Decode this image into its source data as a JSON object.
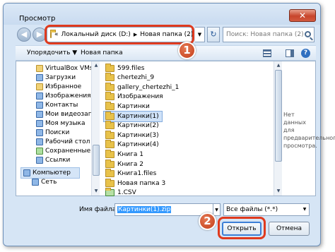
{
  "window": {
    "title": "Просмотр",
    "close_label": "✕"
  },
  "address": {
    "back_label": "◀",
    "forward_label": "▶",
    "prefix": "«",
    "crumbs": [
      "Локальный диск (D:)",
      "Новая папка (2)"
    ],
    "separator": "▶",
    "dropdown_label": "▼",
    "refresh_label": "↻"
  },
  "search": {
    "placeholder": "Поиск: Новая папка (2)"
  },
  "toolbar": {
    "organize_label": "Упорядочить ▼",
    "new_folder_label": "Новая папка",
    "help_label": "?"
  },
  "nav_pane": {
    "items": [
      {
        "label": "VirtualBox VMs",
        "icon": "folder-icon",
        "color": "yellow"
      },
      {
        "label": "Загрузки",
        "icon": "downloads-icon",
        "color": "blue"
      },
      {
        "label": "Избранное",
        "icon": "favorites-icon",
        "color": "yellow"
      },
      {
        "label": "Изображения",
        "icon": "pictures-icon",
        "color": "blue"
      },
      {
        "label": "Контакты",
        "icon": "contacts-icon",
        "color": "blue"
      },
      {
        "label": "Мои видеозапис",
        "icon": "videos-icon",
        "color": "blue"
      },
      {
        "label": "Моя музыка",
        "icon": "music-icon",
        "color": "blue"
      },
      {
        "label": "Поиски",
        "icon": "search-icon",
        "color": "blue"
      },
      {
        "label": "Рабочий стол",
        "icon": "desktop-icon",
        "color": "blue"
      },
      {
        "label": "Сохраненные иг",
        "icon": "games-icon",
        "color": "green"
      },
      {
        "label": "Ссылки",
        "icon": "links-icon",
        "color": "blue"
      },
      {
        "label": "Компьютер",
        "icon": "computer-icon",
        "color": "blue"
      },
      {
        "label": "Сеть",
        "icon": "network-icon",
        "color": "blue"
      }
    ],
    "selected_index": 11
  },
  "file_list": {
    "items": [
      {
        "label": "599.files",
        "icon": "folder-icon"
      },
      {
        "label": "chertezhi_9",
        "icon": "folder-icon"
      },
      {
        "label": "gallery_chertezhi_1",
        "icon": "folder-icon"
      },
      {
        "label": "Изображения",
        "icon": "folder-icon"
      },
      {
        "label": "Картинки",
        "icon": "folder-icon"
      },
      {
        "label": "Картинки(1)",
        "icon": "folder-icon"
      },
      {
        "label": "Картинки(2)",
        "icon": "folder-icon"
      },
      {
        "label": "Картинки(3)",
        "icon": "folder-icon"
      },
      {
        "label": "Картинки(4)",
        "icon": "folder-icon"
      },
      {
        "label": "Книга 1",
        "icon": "folder-icon"
      },
      {
        "label": "Книга 2",
        "icon": "folder-icon"
      },
      {
        "label": "Книга1.files",
        "icon": "folder-icon"
      },
      {
        "label": "Новая папка 3",
        "icon": "folder-icon"
      },
      {
        "label": "1.CSV",
        "icon": "csv-file-icon"
      }
    ],
    "selected_index": 5
  },
  "preview_text": "Нет данных для предварительного просмотра.",
  "filename": {
    "label": "Имя файла:",
    "value": "Картинки(1).zip"
  },
  "filetype": {
    "value": "Все файлы (*.*)"
  },
  "buttons": {
    "open_label": "Открыть",
    "cancel_label": "Отмена"
  },
  "annotations": {
    "badge_1": "1",
    "badge_2": "2",
    "accent_color": "#e03a1e"
  }
}
